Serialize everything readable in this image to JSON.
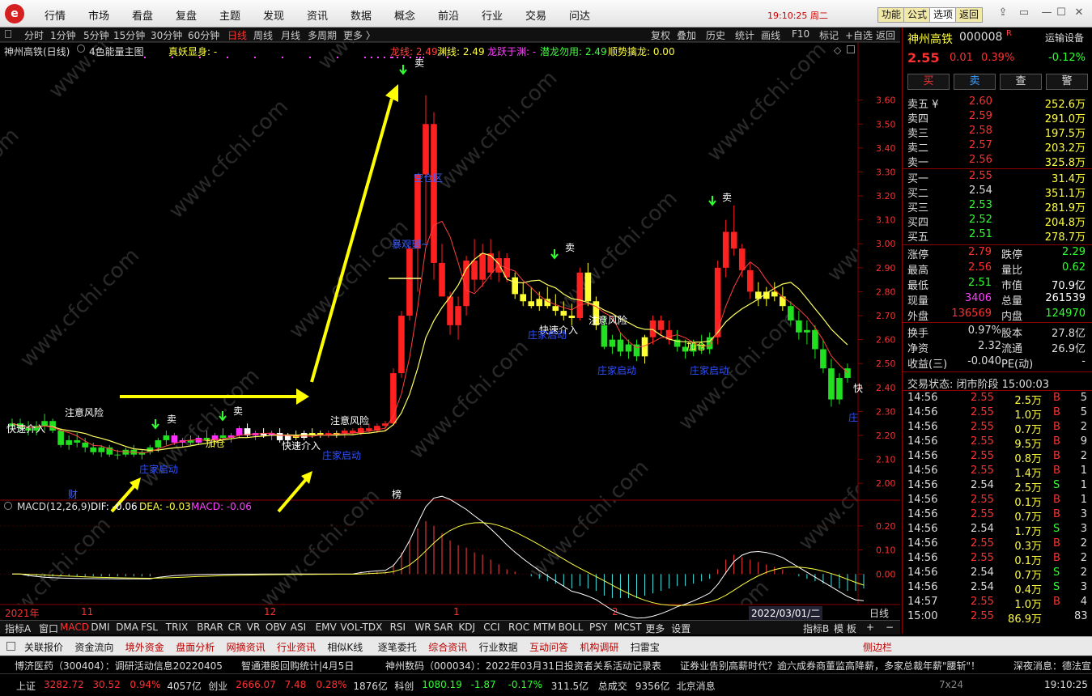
{
  "menu": {
    "logo": "e",
    "items": [
      "行情",
      "市场",
      "看盘",
      "复盘",
      "主题",
      "发现",
      "资讯",
      "数据",
      "概念",
      "前沿",
      "行业",
      "交易",
      "问达"
    ],
    "clock": "19:10:25 周二",
    "buttons": [
      "功能",
      "公式",
      "选项",
      "返回"
    ]
  },
  "periods": {
    "items": [
      "分时",
      "1分钟",
      "5分钟",
      "15分钟",
      "30分钟",
      "60分钟",
      "日线",
      "周线",
      "月线",
      "多周期",
      "更多 〉"
    ],
    "active": "日线",
    "tools": [
      "复权",
      "叠加",
      "历史",
      "统计",
      "画线",
      "F10",
      "标记",
      "+自选",
      "返回"
    ]
  },
  "chart": {
    "stock_title": "神州高铁(日线)",
    "indicator_name": "4色能量主图",
    "zhenyao": "真妖显身: -",
    "indicator_values": [
      {
        "label": "龙线: 2.49",
        "color": "#ff4040"
      },
      {
        "label": "渊线: 2.49",
        "color": "#ffff40"
      },
      {
        "label": "龙跃于渊: -",
        "color": "#ff40ff"
      },
      {
        "label": "潜龙勿用: 2.49",
        "color": "#40ff40"
      },
      {
        "label": "顺势擒龙: 0.00",
        "color": "#ffff40"
      }
    ],
    "y_ticks": [
      "3.60",
      "3.50",
      "3.40",
      "3.30",
      "3.20",
      "3.10",
      "3.00",
      "2.90",
      "2.80",
      "2.70",
      "2.60",
      "2.50",
      "2.40",
      "2.30",
      "2.20",
      "2.10",
      "2.00"
    ],
    "annotations": [
      {
        "t": "注意风险",
        "c": "#ffffff"
      },
      {
        "t": "快速介入",
        "c": "#ffffff"
      },
      {
        "t": "庄家启动",
        "c": "#3050ff"
      },
      {
        "t": "加仓",
        "c": "#ffff40"
      },
      {
        "t": "卖",
        "c": "#ffffff"
      },
      {
        "t": "空仓区",
        "c": "#4060ff"
      },
      {
        "t": "暴观望~",
        "c": "#4060ff"
      },
      {
        "t": "财",
        "c": "#4060ff"
      },
      {
        "t": "榜",
        "c": "#ffffff"
      },
      {
        "t": "庄",
        "c": "#3050ff"
      },
      {
        "t": "快",
        "c": "#ffffff"
      }
    ],
    "macd_label": "MACD(12,26,9)",
    "macd_values": [
      {
        "label": "DIF: -0.06",
        "color": "#ffffff"
      },
      {
        "label": "DEA: -0.03",
        "color": "#ffff40"
      },
      {
        "label": "MACD: -0.06",
        "color": "#ff40ff"
      }
    ],
    "macd_ticks": [
      "0.20",
      "0.10",
      "0.00"
    ],
    "date_labels": [
      "2021年",
      "11",
      "12",
      "1",
      "2"
    ],
    "date_cursor": "2022/03/01/二",
    "period_tag": "日线"
  },
  "quote": {
    "name": "神州高铁",
    "code": "000008",
    "r_badge": "R",
    "sector": "运输设备",
    "sector_change": "-0.12%",
    "price": "2.55",
    "change": "0.01",
    "change_pct": "0.39%",
    "actions": [
      "买",
      "卖",
      "查",
      "警"
    ],
    "asks": [
      {
        "label": "卖五 ¥",
        "price": "2.60",
        "vol": "252.6万"
      },
      {
        "label": "卖四",
        "price": "2.59",
        "vol": "291.0万"
      },
      {
        "label": "卖三",
        "price": "2.58",
        "vol": "197.5万"
      },
      {
        "label": "卖二",
        "price": "2.57",
        "vol": "203.2万"
      },
      {
        "label": "卖一",
        "price": "2.56",
        "vol": "325.8万"
      }
    ],
    "bids": [
      {
        "label": "买一",
        "price": "2.55",
        "vol": "31.4万"
      },
      {
        "label": "买二",
        "price": "2.54",
        "vol": "351.1万"
      },
      {
        "label": "买三",
        "price": "2.53",
        "vol": "281.9万"
      },
      {
        "label": "买四",
        "price": "2.52",
        "vol": "204.8万"
      },
      {
        "label": "买五",
        "price": "2.51",
        "vol": "278.7万"
      }
    ],
    "stats": [
      {
        "k1": "涨停",
        "v1": "2.79",
        "c1": "#ff3030",
        "k2": "跌停",
        "v2": "2.29",
        "c2": "#30ff30"
      },
      {
        "k1": "最高",
        "v1": "2.56",
        "c1": "#ff3030",
        "k2": "量比",
        "v2": "0.62",
        "c2": "#30ff30"
      },
      {
        "k1": "最低",
        "v1": "2.51",
        "c1": "#30ff30",
        "k2": "市值",
        "v2": "70.9亿",
        "c2": "#ffffff"
      },
      {
        "k1": "现量",
        "v1": "3406",
        "c1": "#ff40ff",
        "k2": "总量",
        "v2": "261539",
        "c2": "#ffffff"
      },
      {
        "k1": "外盘",
        "v1": "136569",
        "c1": "#ff3030",
        "k2": "内盘",
        "v2": "124970",
        "c2": "#30ff30"
      }
    ],
    "stats2": [
      {
        "k1": "换手",
        "v1": "0.97%",
        "k2": "股本",
        "v2": "27.8亿"
      },
      {
        "k1": "净资",
        "v1": "2.32",
        "k2": "流通",
        "v2": "26.9亿"
      },
      {
        "k1": "收益(三)",
        "v1": "-0.040",
        "k2": "PE(动)",
        "v2": "-"
      }
    ],
    "trade_status": "交易状态: 闭市阶段 15:00:03",
    "ticks": [
      {
        "t": "14:56",
        "p": "2.55",
        "v": "2.5万",
        "s": "B",
        "n": "5"
      },
      {
        "t": "14:56",
        "p": "2.55",
        "v": "1.0万",
        "s": "B",
        "n": "5"
      },
      {
        "t": "14:56",
        "p": "2.55",
        "v": "0.7万",
        "s": "B",
        "n": "2"
      },
      {
        "t": "14:56",
        "p": "2.55",
        "v": "9.5万",
        "s": "B",
        "n": "9"
      },
      {
        "t": "14:56",
        "p": "2.55",
        "v": "0.8万",
        "s": "B",
        "n": "2"
      },
      {
        "t": "14:56",
        "p": "2.55",
        "v": "1.4万",
        "s": "B",
        "n": "1"
      },
      {
        "t": "14:56",
        "p": "2.54",
        "v": "2.5万",
        "s": "S",
        "n": "1"
      },
      {
        "t": "14:56",
        "p": "2.55",
        "v": "0.1万",
        "s": "B",
        "n": "1"
      },
      {
        "t": "14:56",
        "p": "2.55",
        "v": "0.7万",
        "s": "B",
        "n": "3"
      },
      {
        "t": "14:56",
        "p": "2.54",
        "v": "1.7万",
        "s": "S",
        "n": "3"
      },
      {
        "t": "14:56",
        "p": "2.55",
        "v": "0.3万",
        "s": "B",
        "n": "2"
      },
      {
        "t": "14:56",
        "p": "2.55",
        "v": "0.1万",
        "s": "B",
        "n": "2"
      },
      {
        "t": "14:56",
        "p": "2.54",
        "v": "0.7万",
        "s": "S",
        "n": "2"
      },
      {
        "t": "14:56",
        "p": "2.54",
        "v": "0.4万",
        "s": "S",
        "n": "3"
      },
      {
        "t": "14:57",
        "p": "2.55",
        "v": "1.0万",
        "s": "B",
        "n": "4"
      },
      {
        "t": "15:00",
        "p": "2.55",
        "v": "86.9万",
        "s": "",
        "n": "83"
      }
    ],
    "bottom_tabs": [
      "笔",
      "价",
      "细",
      "势",
      "联",
      "值",
      "主",
      "筹"
    ]
  },
  "indicator_tabs": {
    "left": [
      "指标A",
      "窗口"
    ],
    "items": [
      "MACD",
      "DMI",
      "DMA",
      "FSL",
      "TRIX",
      "BRAR",
      "CR",
      "VR",
      "OBV",
      "ASI",
      "EMV",
      "VOL-TDX",
      "RSI",
      "WR",
      "SAR",
      "KDJ",
      "CCI",
      "ROC",
      "MTM",
      "BOLL",
      "PSY",
      "MCST",
      "更多",
      "设置"
    ],
    "active": "MACD",
    "right": [
      "指标B",
      "模 板",
      "+",
      "−"
    ]
  },
  "func_bar": {
    "items": [
      {
        "t": "关联报价",
        "c": "#111"
      },
      {
        "t": "资金流向",
        "c": "#111"
      },
      {
        "t": "境外资金",
        "c": "#b00"
      },
      {
        "t": "盘面分析",
        "c": "#b00"
      },
      {
        "t": "网摘资讯",
        "c": "#b00"
      },
      {
        "t": "行业资讯",
        "c": "#b00"
      },
      {
        "t": "相似K线",
        "c": "#111"
      },
      {
        "t": "逐笔委托",
        "c": "#111"
      },
      {
        "t": "综合资讯",
        "c": "#b00"
      },
      {
        "t": "行业数据",
        "c": "#111"
      },
      {
        "t": "互动问答",
        "c": "#b00"
      },
      {
        "t": "机构调研",
        "c": "#b00"
      },
      {
        "t": "扫雷宝",
        "c": "#111"
      }
    ],
    "side": "侧边栏"
  },
  "news": {
    "items": [
      "博济医药（300404）：调研活动信息20220405",
      "智通港股回购统计|4月5日",
      "神州数码（000034）：2022年03月31日投资者关系活动记录表",
      "证券业告别高薪时代？逾六成券商董监高降薪，多家总裁年薪\"腰斩\"！"
    ],
    "right": "深夜消息：德法宣"
  },
  "status": {
    "items": [
      {
        "t": "上证",
        "c": "#ddd"
      },
      {
        "t": "3282.72",
        "c": "#ff3030"
      },
      {
        "t": "30.52",
        "c": "#ff3030"
      },
      {
        "t": "0.94%",
        "c": "#ff3030"
      },
      {
        "t": "4057亿",
        "c": "#ddd"
      },
      {
        "t": "创业",
        "c": "#ddd"
      },
      {
        "t": "2666.07",
        "c": "#ff3030"
      },
      {
        "t": "7.48",
        "c": "#ff3030"
      },
      {
        "t": "0.28%",
        "c": "#ff3030"
      },
      {
        "t": "1876亿",
        "c": "#ddd"
      },
      {
        "t": "科创",
        "c": "#ddd"
      },
      {
        "t": "1080.19",
        "c": "#30ff30"
      },
      {
        "t": "-1.87",
        "c": "#30ff30"
      },
      {
        "t": "-0.17%",
        "c": "#30ff30"
      },
      {
        "t": "311.5亿",
        "c": "#ddd"
      },
      {
        "t": "总成交",
        "c": "#ddd"
      },
      {
        "t": "9356亿",
        "c": "#ddd"
      },
      {
        "t": "北京消息",
        "c": "#ddd"
      }
    ],
    "right_clock": "19:10:25",
    "mini_clock": "7x24"
  },
  "watermark": "www.cfchi.com",
  "chart_data": {
    "type": "candlestick",
    "title": "神州高铁(日线)",
    "y_range": [
      1.95,
      3.68
    ],
    "candles": [
      [
        2.24,
        2.27,
        2.22,
        2.25
      ],
      [
        2.25,
        2.27,
        2.22,
        2.23
      ],
      [
        2.23,
        2.26,
        2.2,
        2.22
      ],
      [
        2.22,
        2.26,
        2.2,
        2.24
      ],
      [
        2.24,
        2.29,
        2.22,
        2.26
      ],
      [
        2.26,
        2.27,
        2.21,
        2.22
      ],
      [
        2.22,
        2.23,
        2.15,
        2.16
      ],
      [
        2.16,
        2.2,
        2.14,
        2.18
      ],
      [
        2.18,
        2.21,
        2.15,
        2.17
      ],
      [
        2.17,
        2.19,
        2.13,
        2.15
      ],
      [
        2.15,
        2.17,
        2.12,
        2.13
      ],
      [
        2.13,
        2.16,
        2.11,
        2.15
      ],
      [
        2.15,
        2.16,
        2.11,
        2.12
      ],
      [
        2.12,
        2.14,
        2.1,
        2.12
      ],
      [
        2.12,
        2.15,
        2.11,
        2.14
      ],
      [
        2.14,
        2.16,
        2.11,
        2.12
      ],
      [
        2.12,
        2.14,
        2.1,
        2.13
      ],
      [
        2.13,
        2.16,
        2.12,
        2.15
      ],
      [
        2.15,
        2.19,
        2.13,
        2.18
      ],
      [
        2.18,
        2.22,
        2.16,
        2.2
      ],
      [
        2.2,
        2.21,
        2.16,
        2.17
      ],
      [
        2.17,
        2.19,
        2.15,
        2.18
      ],
      [
        2.18,
        2.2,
        2.16,
        2.17
      ],
      [
        2.17,
        2.2,
        2.16,
        2.19
      ],
      [
        2.19,
        2.22,
        2.17,
        2.18
      ],
      [
        2.18,
        2.21,
        2.16,
        2.2
      ],
      [
        2.2,
        2.23,
        2.18,
        2.19
      ],
      [
        2.19,
        2.21,
        2.17,
        2.2
      ],
      [
        2.2,
        2.24,
        2.19,
        2.23
      ],
      [
        2.23,
        2.25,
        2.19,
        2.2
      ],
      [
        2.2,
        2.22,
        2.18,
        2.21
      ],
      [
        2.21,
        2.23,
        2.19,
        2.2
      ],
      [
        2.2,
        2.22,
        2.18,
        2.21
      ],
      [
        2.21,
        2.23,
        2.17,
        2.18
      ],
      [
        2.18,
        2.21,
        2.17,
        2.2
      ],
      [
        2.2,
        2.22,
        2.18,
        2.19
      ],
      [
        2.19,
        2.22,
        2.18,
        2.21
      ],
      [
        2.21,
        2.23,
        2.19,
        2.2
      ],
      [
        2.2,
        2.22,
        2.19,
        2.21
      ],
      [
        2.21,
        2.22,
        2.19,
        2.2
      ],
      [
        2.2,
        2.22,
        2.19,
        2.21
      ],
      [
        2.21,
        2.23,
        2.19,
        2.22
      ],
      [
        2.22,
        2.23,
        2.2,
        2.21
      ],
      [
        2.21,
        2.24,
        2.2,
        2.23
      ],
      [
        2.23,
        2.25,
        2.21,
        2.22
      ],
      [
        2.22,
        2.25,
        2.21,
        2.24
      ],
      [
        2.24,
        2.26,
        2.22,
        2.25
      ],
      [
        2.25,
        2.48,
        2.24,
        2.46
      ],
      [
        2.46,
        2.72,
        2.44,
        2.7
      ],
      [
        2.7,
        2.99,
        2.68,
        2.98
      ],
      [
        2.98,
        3.29,
        2.8,
        3.29
      ],
      [
        3.29,
        3.62,
        3.0,
        3.5
      ],
      [
        3.5,
        3.55,
        2.85,
        2.92
      ],
      [
        2.92,
        3.0,
        2.78,
        2.78
      ],
      [
        2.78,
        2.8,
        2.62,
        2.66
      ],
      [
        2.66,
        2.78,
        2.6,
        2.74
      ],
      [
        2.74,
        2.95,
        2.7,
        2.93
      ],
      [
        2.93,
        3.02,
        2.8,
        2.85
      ],
      [
        2.85,
        3.0,
        2.82,
        2.96
      ],
      [
        2.96,
        3.02,
        2.85,
        2.88
      ],
      [
        2.88,
        2.97,
        2.84,
        2.94
      ],
      [
        2.94,
        2.96,
        2.84,
        2.86
      ],
      [
        2.86,
        2.88,
        2.77,
        2.79
      ],
      [
        2.79,
        2.84,
        2.74,
        2.76
      ],
      [
        2.76,
        2.82,
        2.73,
        2.74
      ],
      [
        2.74,
        2.8,
        2.72,
        2.77
      ],
      [
        2.77,
        2.82,
        2.73,
        2.74
      ],
      [
        2.74,
        2.79,
        2.7,
        2.72
      ],
      [
        2.72,
        2.76,
        2.68,
        2.7
      ],
      [
        2.7,
        2.75,
        2.66,
        2.69
      ],
      [
        2.69,
        2.9,
        2.68,
        2.88
      ],
      [
        2.88,
        2.92,
        2.74,
        2.76
      ],
      [
        2.76,
        2.78,
        2.64,
        2.66
      ],
      [
        2.66,
        2.7,
        2.56,
        2.57
      ],
      [
        2.57,
        2.62,
        2.54,
        2.6
      ],
      [
        2.6,
        2.63,
        2.53,
        2.55
      ],
      [
        2.55,
        2.6,
        2.52,
        2.58
      ],
      [
        2.58,
        2.6,
        2.51,
        2.53
      ],
      [
        2.53,
        2.62,
        2.5,
        2.61
      ],
      [
        2.61,
        2.7,
        2.58,
        2.68
      ],
      [
        2.68,
        2.7,
        2.62,
        2.64
      ],
      [
        2.64,
        2.68,
        2.58,
        2.6
      ],
      [
        2.6,
        2.64,
        2.55,
        2.57
      ],
      [
        2.57,
        2.6,
        2.52,
        2.55
      ],
      [
        2.55,
        2.6,
        2.53,
        2.58
      ],
      [
        2.58,
        2.62,
        2.54,
        2.56
      ],
      [
        2.56,
        2.63,
        2.54,
        2.61
      ],
      [
        2.61,
        2.93,
        2.58,
        2.9
      ],
      [
        2.9,
        3.1,
        2.86,
        3.05
      ],
      [
        3.05,
        3.16,
        2.95,
        2.98
      ],
      [
        2.98,
        3.0,
        2.86,
        2.89
      ],
      [
        2.89,
        2.92,
        2.77,
        2.8
      ],
      [
        2.8,
        2.84,
        2.74,
        2.77
      ],
      [
        2.77,
        2.82,
        2.74,
        2.8
      ],
      [
        2.8,
        2.84,
        2.76,
        2.78
      ],
      [
        2.78,
        2.82,
        2.72,
        2.74
      ],
      [
        2.74,
        2.76,
        2.66,
        2.68
      ],
      [
        2.68,
        2.72,
        2.6,
        2.63
      ],
      [
        2.63,
        2.68,
        2.58,
        2.64
      ],
      [
        2.64,
        2.66,
        2.52,
        2.56
      ],
      [
        2.56,
        2.6,
        2.46,
        2.48
      ],
      [
        2.48,
        2.52,
        2.32,
        2.35
      ],
      [
        2.35,
        2.46,
        2.33,
        2.44
      ],
      [
        2.44,
        2.5,
        2.42,
        2.48
      ]
    ],
    "colors": [
      "g",
      "g",
      "g",
      "g",
      "g",
      "g",
      "g",
      "g",
      "g",
      "g",
      "g",
      "g",
      "g",
      "g",
      "g",
      "g",
      "g",
      "g",
      "g",
      "g",
      "m",
      "m",
      "g",
      "m",
      "g",
      "m",
      "g",
      "m",
      "m",
      "w",
      "m",
      "w",
      "m",
      "w",
      "w",
      "y",
      "w",
      "y",
      "y",
      "r",
      "y",
      "r",
      "r",
      "r",
      "r",
      "r",
      "r",
      "r",
      "r",
      "r",
      "r",
      "r",
      "r",
      "r",
      "r",
      "r",
      "r",
      "r",
      "r",
      "r",
      "r",
      "r",
      "y",
      "y",
      "y",
      "y",
      "y",
      "y",
      "y",
      "y",
      "r",
      "y",
      "y",
      "g",
      "g",
      "g",
      "g",
      "g",
      "y",
      "r",
      "r",
      "r",
      "g",
      "g",
      "g",
      "g",
      "g",
      "r",
      "r",
      "r",
      "r",
      "r",
      "y",
      "y",
      "y",
      "y",
      "g",
      "g",
      "g",
      "g",
      "g",
      "g",
      "g",
      "g"
    ],
    "macd": [
      0.0,
      0.0,
      -0.01,
      -0.01,
      -0.01,
      -0.01,
      -0.01,
      -0.01,
      -0.01,
      -0.01,
      -0.01,
      -0.01,
      -0.01,
      -0.01,
      -0.01,
      -0.01,
      -0.01,
      -0.01,
      0.0,
      0.0,
      0.0,
      0.0,
      0.0,
      0.0,
      0.0,
      0.0,
      0.0,
      0.0,
      0.0,
      0.0,
      0.0,
      0.0,
      0.0,
      0.0,
      0.0,
      0.0,
      0.0,
      0.0,
      0.0,
      0.0,
      0.0,
      0.0,
      0.0,
      0.01,
      0.01,
      0.01,
      0.01,
      0.04,
      0.09,
      0.14,
      0.19,
      0.22,
      0.2,
      0.17,
      0.14,
      0.12,
      0.11,
      0.09,
      0.08,
      0.06,
      0.04,
      0.02,
      0.01,
      0.0,
      -0.01,
      -0.02,
      -0.03,
      -0.04,
      -0.05,
      -0.06,
      -0.05,
      -0.06,
      -0.07,
      -0.09,
      -0.1,
      -0.1,
      -0.1,
      -0.1,
      -0.09,
      -0.08,
      -0.07,
      -0.06,
      -0.05,
      -0.05,
      -0.04,
      -0.03,
      -0.02,
      0.02,
      0.06,
      0.08,
      0.07,
      0.06,
      0.05,
      0.04,
      0.03,
      0.02,
      0.0,
      -0.01,
      -0.02,
      -0.03,
      -0.04,
      -0.05,
      -0.06,
      -0.07,
      -0.07,
      -0.06
    ]
  }
}
